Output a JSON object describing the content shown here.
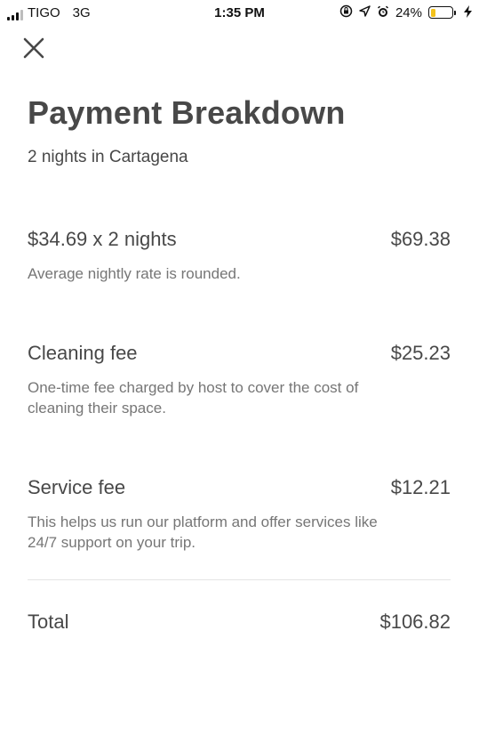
{
  "status_bar": {
    "carrier": "TIGO",
    "network": "3G",
    "time": "1:35 PM",
    "battery": "24%",
    "battery_level": 0.24,
    "battery_color": "#f4c21b",
    "icons": [
      "signal-icon",
      "lock-rotation-icon",
      "location-icon",
      "alarm-icon",
      "battery-icon",
      "charging-icon"
    ]
  },
  "header": {
    "close_icon": "close-icon",
    "title": "Payment Breakdown",
    "subtitle": "2 nights in Cartagena"
  },
  "breakdown": [
    {
      "label": "$34.69 x 2 nights",
      "amount": "$69.38",
      "description": "Average nightly rate is rounded."
    },
    {
      "label": "Cleaning fee",
      "amount": "$25.23",
      "description": "One-time fee charged by host to cover the cost of cleaning their space."
    },
    {
      "label": "Service fee",
      "amount": "$12.21",
      "description": "This helps us run our platform and offer services like 24/7 support on your trip."
    }
  ],
  "total": {
    "label": "Total",
    "amount": "$106.82"
  }
}
